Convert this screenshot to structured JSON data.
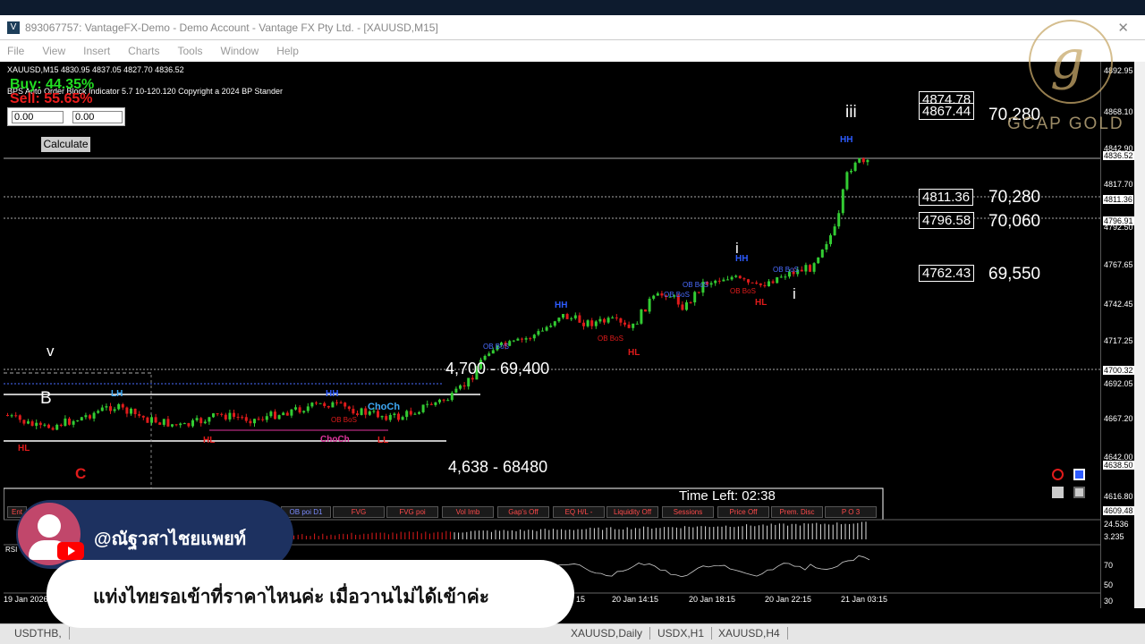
{
  "window": {
    "title": "893067757: VantageFX-Demo - Demo Account - Vantage FX Pty Ltd. - [XAUUSD,M15]",
    "close_glyph": "✕"
  },
  "menu": [
    "File",
    "View",
    "Insert",
    "Charts",
    "Tools",
    "Window",
    "Help"
  ],
  "chart": {
    "symbol_info": "XAUUSD,M15  4830.95 4837.05 4827.70 4836.52",
    "indicator_info": "BPS Auto Order Block Indicator  5.7 10-120.120 Copyright a 2024 BP Stander",
    "buy": "Buy: 44.35%",
    "sell": "Sell: 55.65%",
    "input1": "0.00",
    "input2": "0.00",
    "calculate": "Calculate",
    "levels": [
      {
        "box": "4874.78",
        "big": ""
      },
      {
        "box": "4867.44",
        "big": "70,280"
      },
      {
        "box": "4811.36",
        "big": "70,280"
      },
      {
        "box": "4796.58",
        "big": "70,060"
      },
      {
        "box": "4762.43",
        "big": "69,550"
      }
    ],
    "ann_4700": "4,700 - 69,400",
    "ann_4638": "4,638 - 68480",
    "time_left": "Time Left: 02:38",
    "wave_v": "v",
    "wave_B": "B",
    "wave_C": "C",
    "wave_iii": "iii",
    "wave_i1": "i",
    "wave_i2": "i",
    "labels": {
      "HH": "HH",
      "HL": "HL",
      "LH": "LH",
      "LL": "LL",
      "OBBoS": "OB BoS",
      "ChoCh": "ChoCh"
    }
  },
  "price_scale": [
    "4892.95",
    "4868.10",
    "4842.90",
    "4836.52",
    "4817.70",
    "4811.36",
    "4796.91",
    "4792.50",
    "4767.65",
    "4742.45",
    "4717.25",
    "4700.32",
    "4692.05",
    "4667.20",
    "4642.00",
    "4638.50",
    "4616.80",
    "4609.48",
    "24.536",
    "3.235",
    "70",
    "50",
    "30"
  ],
  "panel_buttons": [
    "Ent",
    "OB poi D1",
    "FVG",
    "FVG poi",
    "Vol Imb",
    "Gap's Off",
    "EQ H/L -",
    "Liquidity Off",
    "Sessions",
    "Price Off",
    "Prem. Disc",
    "P O 3"
  ],
  "rsi_label": "RSI",
  "time_axis": [
    "19 Jan 2026",
    "20 Jan 14:15",
    "20 Jan 18:15",
    "20 Jan 22:15",
    "21 Jan 03:15"
  ],
  "time_axis_partial": "15",
  "tabs": [
    "USDTHB,",
    "XAUUSD,Daily",
    "USDX,H1",
    "XAUUSD,H4"
  ],
  "watermark": {
    "brand": "GCAP GOLD"
  },
  "overlay": {
    "name": "@ณัฐวสาไชยแพยท์",
    "message": "แท่งไทยรอเข้าที่ราคาไหนค่ะ เมื่อวานไม่ได้เข้าค่ะ"
  },
  "colors": {
    "bull": "#33cc33",
    "bear": "#e01b1b",
    "hh": "#2d5bff",
    "hl": "#e01b1b",
    "choch": "#3fa9f5",
    "overlay_bubble": "#1d3160"
  }
}
